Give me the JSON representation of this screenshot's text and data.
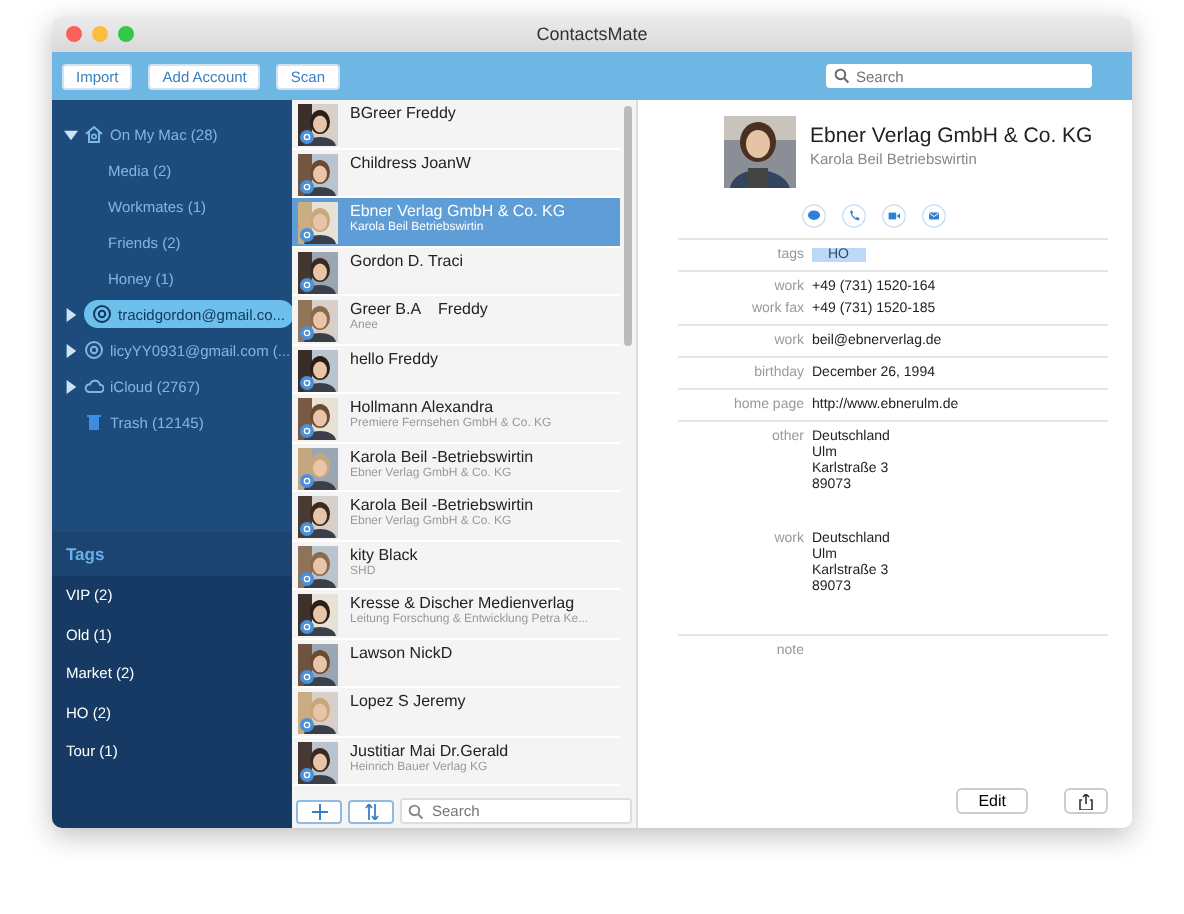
{
  "window": {
    "title": "ContactsMate"
  },
  "toolbar": {
    "buttons": [
      "Import",
      "Add Account",
      "Scan"
    ],
    "search": {
      "placeholder": "Search"
    }
  },
  "sidebar": {
    "sources": [
      {
        "label": "On My Mac (28)",
        "kind": "mac",
        "expanded": true,
        "selected": false,
        "children": [
          {
            "label": "Media (2)",
            "selected": false
          },
          {
            "label": "Workmates (1)",
            "selected": false
          },
          {
            "label": "Friends (2)",
            "selected": false
          },
          {
            "label": "Honey (1)",
            "selected": false
          }
        ]
      },
      {
        "label": "tracidgordon@gmail.co...",
        "kind": "account",
        "expanded": false,
        "selected": true
      },
      {
        "label": "licyYY0931@gmail.com (...",
        "kind": "account",
        "expanded": false,
        "selected": false
      },
      {
        "label": "iCloud (2767)",
        "kind": "cloud",
        "expanded": false,
        "selected": false
      },
      {
        "label": "Trash (12145)",
        "kind": "trash",
        "selected": false
      }
    ],
    "tags": {
      "title": "Tags",
      "items": [
        {
          "label": "VIP (2)",
          "selected": false
        },
        {
          "label": "Old (1)",
          "selected": false
        },
        {
          "label": "Market (2)",
          "selected": false
        },
        {
          "label": "HO (2)",
          "selected": false
        },
        {
          "label": "Tour (1)",
          "selected": false
        }
      ]
    }
  },
  "contacts": {
    "items": [
      {
        "name": "BGreer Freddy",
        "selected": false
      },
      {
        "name": "Childress JoanW",
        "selected": false
      },
      {
        "name": "Ebner Verlag GmbH & Co. KG",
        "subtitle": "Karola Beil Betriebswirtin",
        "selected": true
      },
      {
        "name": "Gordon D. Traci",
        "selected": false
      },
      {
        "name": "Greer B.A    Freddy",
        "subtitle": "Anee",
        "selected": false
      },
      {
        "name": "hello Freddy",
        "selected": false
      },
      {
        "name": "Hollmann Alexandra",
        "subtitle": "Premiere Fernsehen GmbH & Co. KG",
        "selected": false
      },
      {
        "name": "Karola Beil -Betriebswirtin",
        "subtitle": "Ebner Verlag GmbH & Co. KG",
        "selected": false
      },
      {
        "name": "Karola Beil -Betriebswirtin",
        "subtitle": "Ebner Verlag GmbH & Co. KG",
        "selected": false
      },
      {
        "name": "kity Black",
        "subtitle": "SHD",
        "selected": false
      },
      {
        "name": "Kresse & Discher Medienverlag",
        "subtitle": "Leitung Forschung & Entwicklung Petra Ke...",
        "selected": false
      },
      {
        "name": "Lawson NickD",
        "selected": false
      },
      {
        "name": "Lopez S Jeremy",
        "selected": false
      },
      {
        "name": "Justitiar Mai Dr.Gerald",
        "subtitle": "Heinrich Bauer Verlag KG",
        "selected": false
      }
    ],
    "search": {
      "placeholder": "Search"
    }
  },
  "detail": {
    "name": "Ebner Verlag GmbH & Co. KG",
    "subtitle": "Karola Beil Betriebswirtin",
    "actions": [
      {
        "kind": "message"
      },
      {
        "kind": "phone"
      },
      {
        "kind": "video"
      },
      {
        "kind": "mail"
      }
    ],
    "groups": [
      [
        {
          "label": "tags",
          "kind": "tag",
          "value": "HO"
        }
      ],
      [
        {
          "label": "work",
          "kind": "text",
          "value": "+49 (731) 1520-164"
        },
        {
          "label": "work fax",
          "kind": "text",
          "value": "+49 (731) 1520-185"
        }
      ],
      [
        {
          "label": "work",
          "kind": "text",
          "value": "beil@ebnerverlag.de"
        }
      ],
      [
        {
          "label": "birthday",
          "kind": "text",
          "value": "December 26, 1994"
        }
      ],
      [
        {
          "label": "home page",
          "kind": "text",
          "value": "http://www.ebnerulm.de"
        }
      ],
      [
        {
          "label": "other",
          "kind": "address",
          "lines": [
            "Deutschland",
            "Ulm",
            "Karlstraße 3",
            "89073"
          ]
        },
        {
          "label": "work",
          "kind": "address",
          "lines": [
            "Deutschland",
            "Ulm",
            "Karlstraße 3",
            "89073"
          ]
        }
      ],
      [
        {
          "label": "note",
          "kind": "note"
        }
      ]
    ],
    "edit_button": "Edit"
  }
}
